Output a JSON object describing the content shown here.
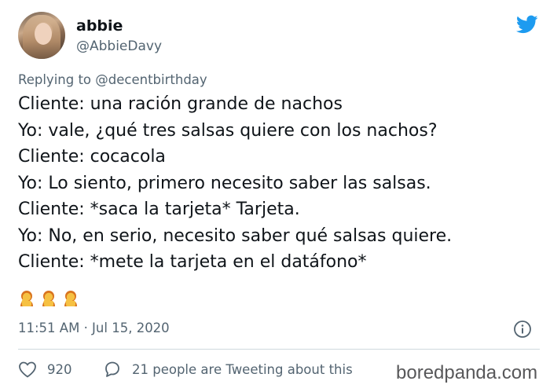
{
  "tweet": {
    "display_name": "abbie",
    "handle": "@AbbieDavy",
    "replying_prefix": "Replying to ",
    "replying_to": "@decentbirthday",
    "lines": [
      "Cliente: una ración grande de nachos",
      "Yo: vale, ¿qué tres salsas quiere con los nachos?",
      "Cliente: cocacola",
      "Yo: Lo siento, primero necesito saber las salsas.",
      "Cliente: *saca la tarjeta* Tarjeta.",
      "Yo: No, en serio, necesito saber qué salsas quiere.",
      "Cliente: *mete la tarjeta en el datáfono*"
    ],
    "emojis": [
      "woman-facepalming-icon",
      "woman-facepalming-icon",
      "woman-facepalming-icon"
    ],
    "timestamp": "11:51 AM · Jul 15, 2020",
    "like_count": "920",
    "tweeting_text": "21 people are Tweeting about this"
  },
  "watermark": "boredpanda.com",
  "colors": {
    "twitter_blue": "#1d9bf0",
    "secondary_text": "#536471",
    "primary_text": "#0f1419",
    "divider": "#cfd9de",
    "emoji_skin": "#f6c143",
    "emoji_hair": "#d9741f"
  }
}
